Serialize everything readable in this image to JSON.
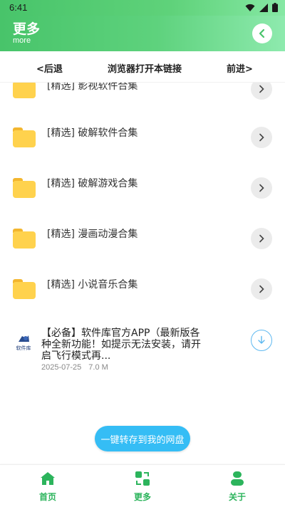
{
  "statusbar": {
    "time": "6:41"
  },
  "appbar": {
    "title": "更多",
    "subtitle": "more"
  },
  "navbar": {
    "back": "<后退",
    "open_browser": "浏览器打开本链接",
    "forward": "前进>"
  },
  "list": {
    "items": [
      {
        "label": "[精选] 影视软件合集"
      },
      {
        "label": "[精选] 破解软件合集"
      },
      {
        "label": "[精选] 破解游戏合集"
      },
      {
        "label": "[精选] 漫画动漫合集"
      },
      {
        "label": "[精选] 小说音乐合集"
      }
    ]
  },
  "app_item": {
    "title": "【必备】软件库官方APP（最新版各种全新功能！如提示无法安装，请开启飞行模式再...",
    "date": "2025-07-25",
    "size": "7.0 M",
    "logo_text": "软件库"
  },
  "save_button": "一键转存到我的网盘",
  "tabbar": {
    "home": "首页",
    "more": "更多",
    "about": "关于"
  },
  "colors": {
    "accent": "#48c46a",
    "save_button": "#35bdf5",
    "folder": "#ffd24d",
    "tab_active": "#2cb45c"
  }
}
